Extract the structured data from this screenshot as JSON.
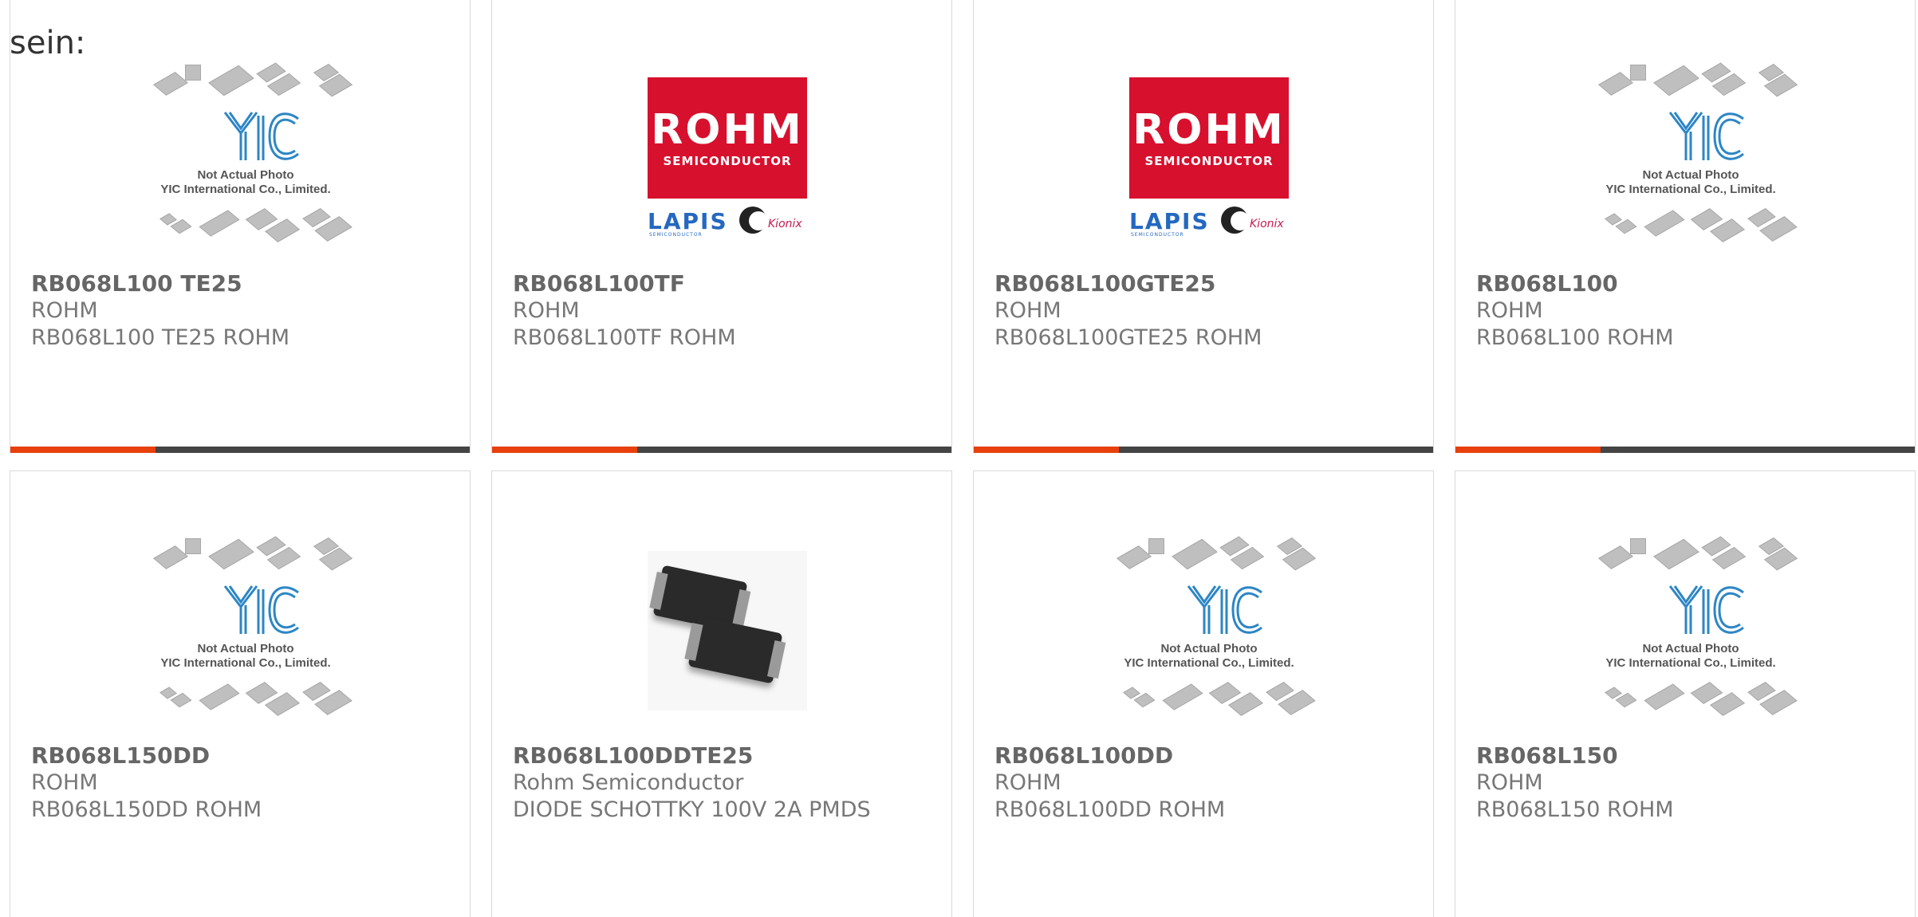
{
  "intro_text": "sein:",
  "placeholder": {
    "line1": "Not Actual Photo",
    "line2": "YIC International Co., Limited."
  },
  "rohm_logo": {
    "word": "ROHM",
    "sub": "SEMICONDUCTOR",
    "lapis": "LAPIS",
    "lapis_sub": "SEMICONDUCTOR",
    "kionix": "Kionix"
  },
  "colors": {
    "accent": "#e8400c",
    "bar": "#444444",
    "rohm_red": "#d7102e"
  },
  "products": [
    {
      "part": "RB068L100 TE25",
      "manufacturer": "ROHM",
      "description": "RB068L100 TE25 ROHM",
      "image": "yic-placeholder"
    },
    {
      "part": "RB068L100TF",
      "manufacturer": "ROHM",
      "description": "RB068L100TF ROHM",
      "image": "rohm-logo"
    },
    {
      "part": "RB068L100GTE25",
      "manufacturer": "ROHM",
      "description": "RB068L100GTE25 ROHM",
      "image": "rohm-logo"
    },
    {
      "part": "RB068L100",
      "manufacturer": "ROHM",
      "description": "RB068L100 ROHM",
      "image": "yic-placeholder"
    },
    {
      "part": "RB068L150DD",
      "manufacturer": "ROHM",
      "description": "RB068L150DD ROHM",
      "image": "yic-placeholder"
    },
    {
      "part": "RB068L100DDTE25",
      "manufacturer": "Rohm Semiconductor",
      "description": "DIODE SCHOTTKY 100V 2A PMDS",
      "image": "diode-photo"
    },
    {
      "part": "RB068L100DD",
      "manufacturer": "ROHM",
      "description": "RB068L100DD ROHM",
      "image": "yic-placeholder"
    },
    {
      "part": "RB068L150",
      "manufacturer": "ROHM",
      "description": "RB068L150 ROHM",
      "image": "yic-placeholder"
    }
  ]
}
